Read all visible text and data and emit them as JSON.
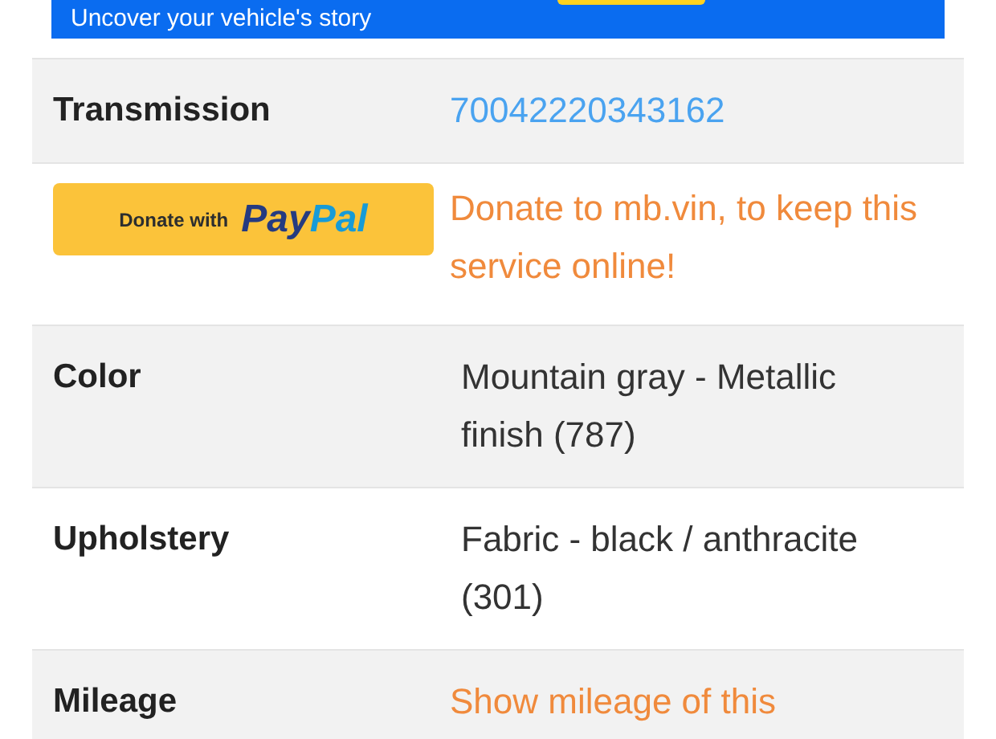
{
  "banner": {
    "tagline": "Uncover your vehicle's story"
  },
  "rows": [
    {
      "kind": "link",
      "label": "Transmission",
      "value": "70042220343162"
    },
    {
      "kind": "donate",
      "button_text": "Donate with",
      "logo_parts": [
        "Pay",
        "Pal"
      ],
      "value": "Donate to mb.vin, to keep this service online!"
    },
    {
      "kind": "plain",
      "label": "Color",
      "value": "Mountain gray - Metallic finish (787)"
    },
    {
      "kind": "plain",
      "label": "Upholstery",
      "value": "Fabric - black / anthracite (301)"
    },
    {
      "kind": "action",
      "label": "Mileage",
      "value": "Show mileage of this"
    }
  ]
}
